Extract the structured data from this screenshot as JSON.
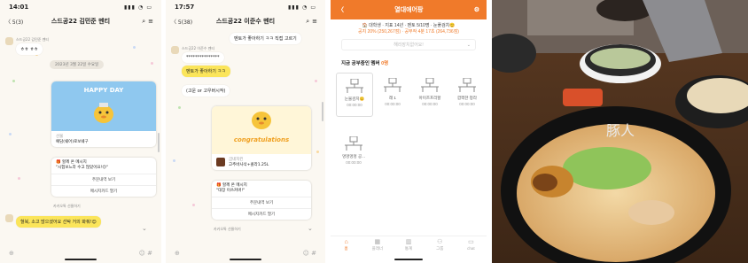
{
  "chat1": {
    "status_time": "14:01",
    "back_label": "〈 5(3)",
    "title": "스드공22 김민준 멘티",
    "sender_name": "스드공22 김민준 멘티",
    "msg1": "ㅎㅎ ㅎㅎ",
    "date_pill": "2023년 3월 22일 수요일",
    "card_banner": "HAPPY DAY",
    "card_caption": "예담(쉐어)로보쉐구",
    "card_caption_small": "선물",
    "gift_line1": "🎁 할께 온 메시지",
    "gift_line2": "\"시험보느라 수고 많았어요!😊\"",
    "btn1": "주문내역 보기",
    "btn2": "메시지카드 열기",
    "gift_note": "카카오톡 선물하기",
    "last_msg": "헐북, 소고 많으셨어요 선탁 거의 봐줘!😊"
  },
  "chat2": {
    "status_time": "17:57",
    "back_label": "〈 5(38)",
    "title": "스드공22 이준수 멘티",
    "top_bubble": "멘토가 좋아하기 ㅋㅋ 직접 고르기",
    "sender_name": "스드공22 이준수 멘티",
    "msg1": "***************",
    "msg2": "멘토가 좋아하기 ㅋㅋ",
    "msg3": "(고운 or 고우버시작)",
    "card_banner": "congratulations",
    "card_caption_small": "굽네치킨",
    "card_caption": "고추바사삭+콜라1.25L",
    "gift_line1": "🎁 할께 온 메시지",
    "gift_line2": "\"대장 이쓰커버!\"",
    "btn1": "주문내역 보기",
    "btn2": "메시지카드 열기",
    "gift_note": "카카오톡 선물하기"
  },
  "app": {
    "title": "열대애어팡",
    "info_line1": "🏠 대학생 · 지표 14년 · 멘토 5/10명 · 눈풀검치😊",
    "info_line2_prefix": "공지 20% (250,267점) · 공부작 4분 17초 (264,736점)",
    "dropdown_placeholder": "해리장치없어요!",
    "section_title": "지금 공부중인 멤버",
    "section_count": "0명",
    "desks": [
      {
        "name": "눈물검치😊",
        "time": "00:00:00"
      },
      {
        "name": "래 1",
        "time": "00:00:00"
      },
      {
        "name": "아이즈프리할",
        "time": "00:00:00"
      },
      {
        "name": "깜짝한 정라",
        "time": "00:00:00"
      },
      {
        "name": "멍멍멍멍 공...",
        "time": "00:00:00"
      }
    ],
    "tabs": [
      {
        "label": "홈",
        "icon": "home-icon"
      },
      {
        "label": "플래너",
        "icon": "calendar-icon"
      },
      {
        "label": "통계",
        "icon": "chart-icon"
      },
      {
        "label": "그룹",
        "icon": "group-icon"
      },
      {
        "label": "chat",
        "icon": "chat-icon"
      }
    ],
    "accent": "#f07a2a"
  },
  "photo": {
    "bowl_text": "豚人"
  }
}
